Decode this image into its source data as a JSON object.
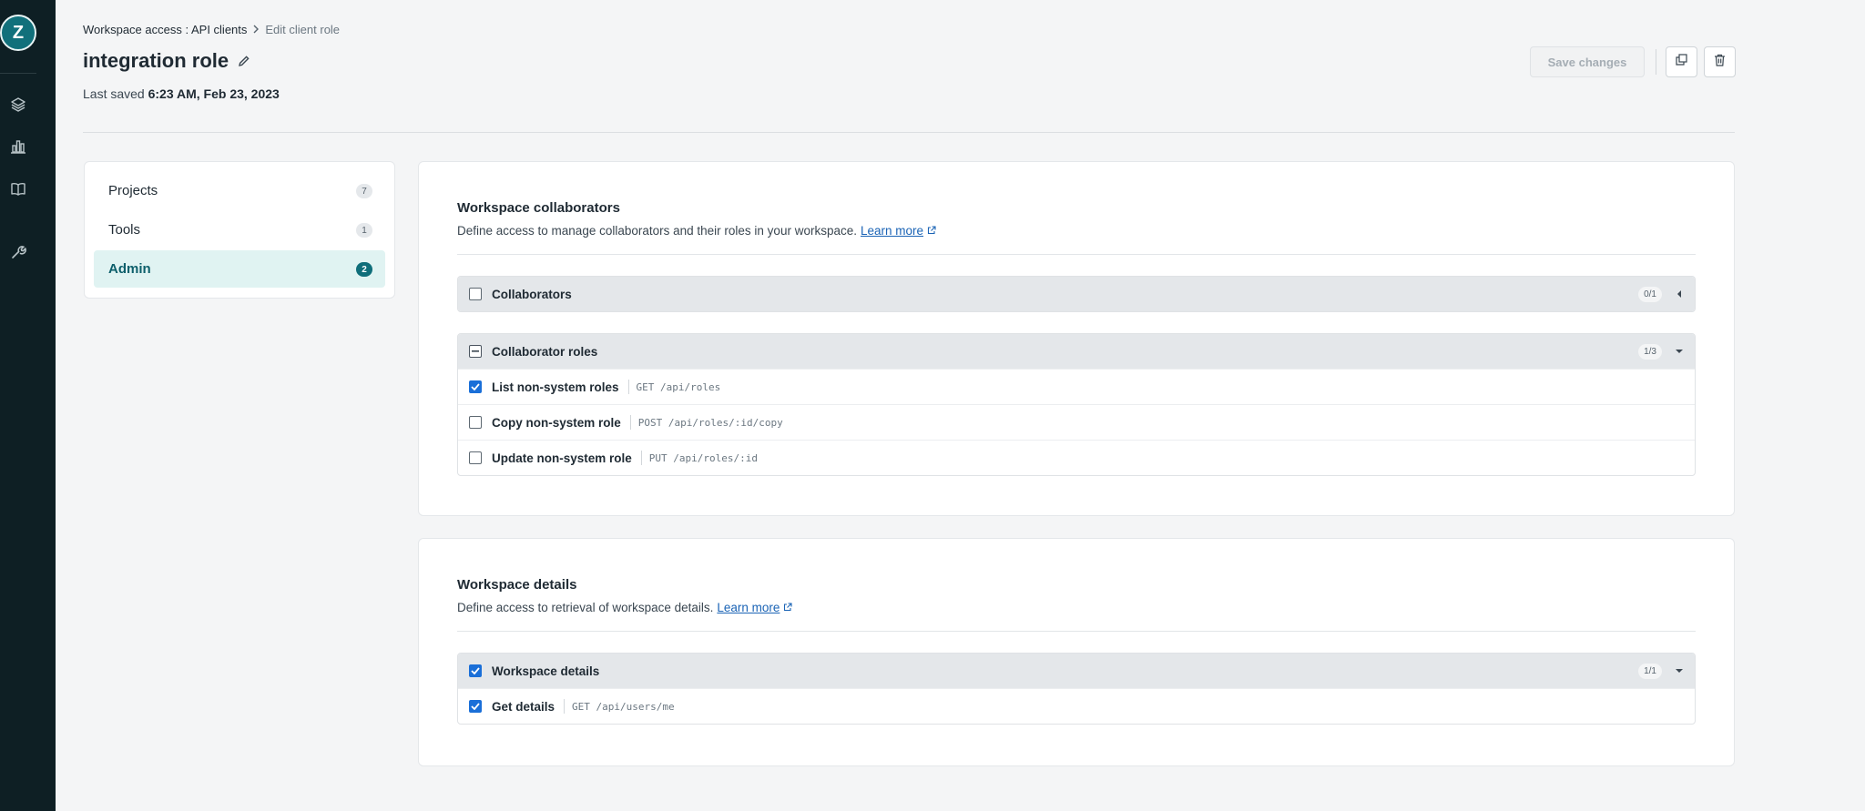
{
  "nav_rail": {
    "avatar_letter": "Z",
    "icons": [
      "layers-icon",
      "bar-chart-icon",
      "book-icon",
      "wrench-icon"
    ]
  },
  "breadcrumb": {
    "parent": "Workspace access : API clients",
    "current": "Edit client role"
  },
  "role": {
    "name": "integration role",
    "last_saved_label": "Last saved",
    "last_saved_value": "6:23 AM, Feb 23, 2023"
  },
  "actions": {
    "save_label": "Save changes",
    "duplicate_icon": "copy-icon",
    "delete_icon": "trash-icon"
  },
  "sidebar": {
    "items": [
      {
        "label": "Projects",
        "count": "7",
        "active": false
      },
      {
        "label": "Tools",
        "count": "1",
        "active": false
      },
      {
        "label": "Admin",
        "count": "2",
        "active": true
      }
    ]
  },
  "sections": [
    {
      "title": "Workspace collaborators",
      "description": "Define access to manage collaborators and their roles in your workspace.",
      "learn_more": "Learn more",
      "groups": [
        {
          "name": "Collaborators",
          "count": "0/1",
          "state": "unchecked",
          "expanded": false,
          "rows": []
        },
        {
          "name": "Collaborator roles",
          "count": "1/3",
          "state": "indeterminate",
          "expanded": true,
          "rows": [
            {
              "label": "List non-system roles",
              "endpoint": "GET /api/roles",
              "checked": true
            },
            {
              "label": "Copy non-system role",
              "endpoint": "POST /api/roles/:id/copy",
              "checked": false
            },
            {
              "label": "Update non-system role",
              "endpoint": "PUT /api/roles/:id",
              "checked": false
            }
          ]
        }
      ]
    },
    {
      "title": "Workspace details",
      "description": "Define access to retrieval of workspace details.",
      "learn_more": "Learn more",
      "groups": [
        {
          "name": "Workspace details",
          "count": "1/1",
          "state": "checked",
          "expanded": true,
          "rows": [
            {
              "label": "Get details",
              "endpoint": "GET /api/users/me",
              "checked": true
            }
          ]
        }
      ]
    }
  ],
  "colors": {
    "rail_bg": "#0e1f24",
    "accent_teal": "#0f6e7a",
    "checkbox_blue": "#1a6fd8",
    "link_blue": "#1a63b5"
  }
}
